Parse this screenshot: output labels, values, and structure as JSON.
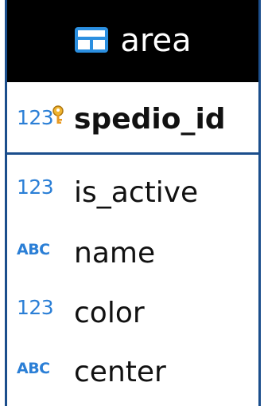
{
  "entity": {
    "title": "area",
    "icon": "table-icon",
    "border_color": "#1b4e8c",
    "header_color": "#000000",
    "icon_color": "#2b7fd6",
    "primary_key": {
      "type_label": "123",
      "type_icon": "numeric-type-icon",
      "key_icon": "key-icon",
      "name": "spedio_id"
    },
    "columns": [
      {
        "type_label": "123",
        "type_icon": "numeric-type-icon",
        "name": "is_active"
      },
      {
        "type_label": "ABC",
        "type_icon": "text-type-icon",
        "name": "name"
      },
      {
        "type_label": "123",
        "type_icon": "numeric-type-icon",
        "name": "color"
      },
      {
        "type_label": "ABC",
        "type_icon": "text-type-icon",
        "name": "center"
      }
    ]
  }
}
